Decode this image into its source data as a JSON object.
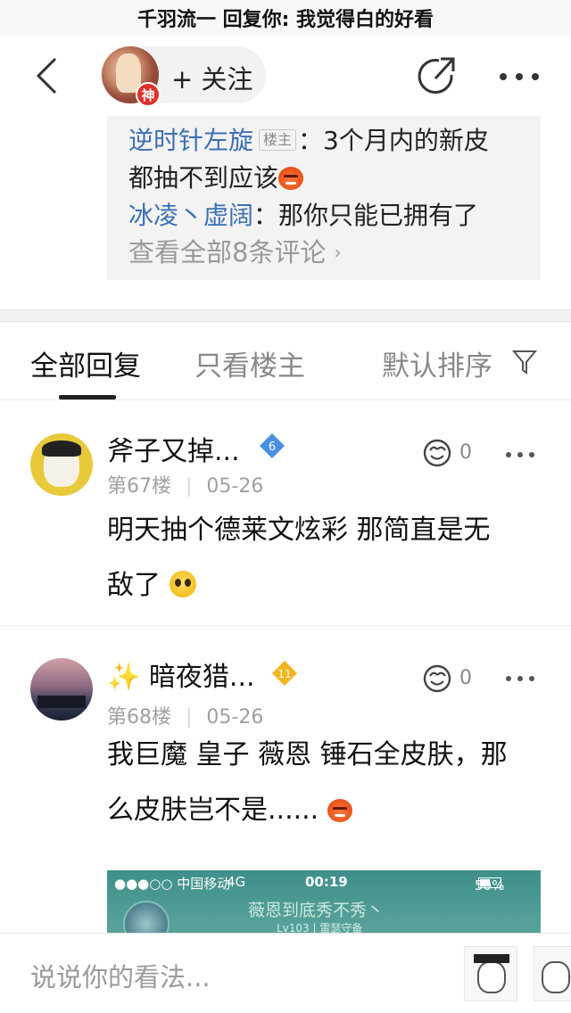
{
  "topbar": {
    "title": "千羽流一 回复你: 我觉得白的好看"
  },
  "header": {
    "back_icon": "chevron-left-icon",
    "badge": "神",
    "follow_label": "+ 关注",
    "share_icon": "share-arrow-icon",
    "more_icon": "more-dots-icon"
  },
  "preview": {
    "comments": [
      {
        "user": "逆时针左旋",
        "tag": "楼主",
        "colon": "：",
        "text1": "3个月内的新皮",
        "text2": "都抽不到应该"
      },
      {
        "user": "冰凌丶虚阔",
        "colon": "：",
        "text": "那你只能已拥有了"
      }
    ],
    "view_all": "查看全部8条评论",
    "view_all_arrow": "›"
  },
  "tabs": {
    "all": "全部回复",
    "owner_only": "只看楼主",
    "sort": "默认排序"
  },
  "replies": [
    {
      "name": "斧子又掉...",
      "level": "6",
      "level_color": "#4a90e2",
      "floor": "第67楼",
      "date": "05-26",
      "likes": "0",
      "line1": "明天抽个德莱文炫彩 那简直是无",
      "line2": "敌了"
    },
    {
      "prefix": "✨",
      "name": "暗夜猎...",
      "level": "11",
      "level_color": "#f2b51e",
      "floor": "第68楼",
      "date": "05-26",
      "likes": "0",
      "line1": "我巨魔 皇子 薇恩 锤石全皮肤，那",
      "line2": "么皮肤岂不是......"
    }
  ],
  "embed": {
    "carrier": "●●●○○ 中国移动",
    "network": "4G",
    "time": "00:19",
    "battery": "50%",
    "title": "薇恩到底秀不秀丶",
    "sub": "Lv103 | 雷瑟守备"
  },
  "input": {
    "placeholder": "说说你的看法..."
  }
}
